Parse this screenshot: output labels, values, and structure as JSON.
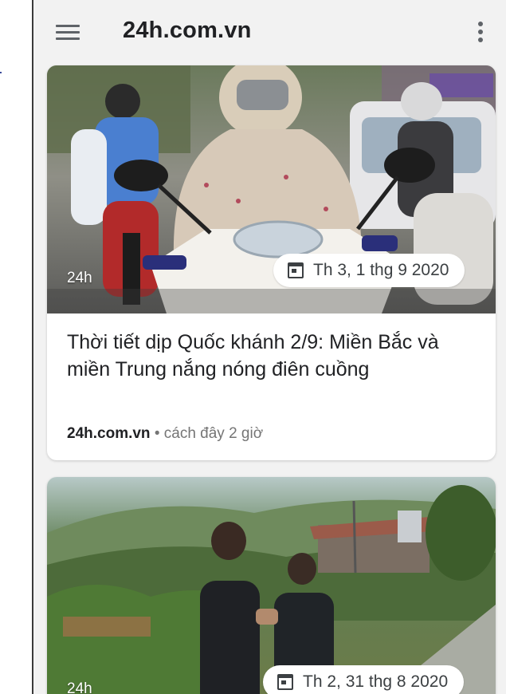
{
  "toolbar": {
    "title": "24h.com.vn",
    "menu_icon": "hamburger-menu-icon",
    "more_icon": "vertical-dots-more-icon"
  },
  "articles": [
    {
      "source_tag": "24h",
      "date": "Th 3, 1 thg 9 2020",
      "headline": "Thời tiết dịp Quốc khánh 2/9: Miền Bắc và miền Trung nắng nóng điên cuồng",
      "site": "24h.com.vn",
      "separator": " • ",
      "time_ago": "cách đây 2 giờ"
    },
    {
      "source_tag": "24h",
      "date": "Th 2, 31 thg 8 2020"
    }
  ],
  "colors": {
    "background": "#f2f2f2",
    "card": "#ffffff",
    "text": "#202124",
    "muted": "#757575"
  }
}
